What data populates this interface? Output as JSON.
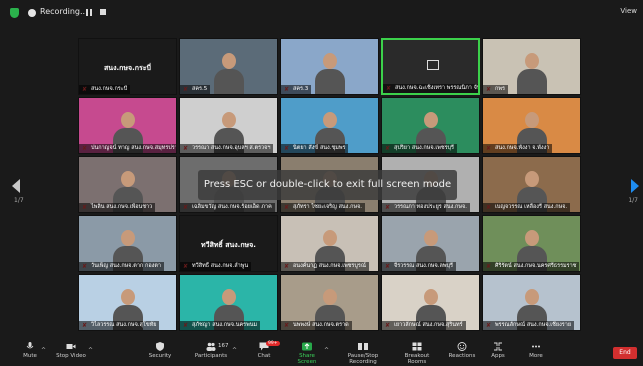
{
  "topbar": {
    "recording_label": "Recording...",
    "view_label": "View"
  },
  "esc_message": "Press ESC or double-click to exit full screen mode",
  "pagination": {
    "left": "1/7",
    "right": "1/7"
  },
  "participants": [
    {
      "name": "สนง.กษจ.กระบี่",
      "center_label": "สนง.กษจ.กระบี่",
      "bg": "#1a1a1a"
    },
    {
      "name": "สคร.5",
      "bg": "#5b6b78"
    },
    {
      "name": "สคร.3",
      "bg": "#8aa7c9"
    },
    {
      "name": "สนง.กษจ.ฉะเชิงเทรา พรรณนิภา จันทร์",
      "bg": "#2a2a2a",
      "video_off": true
    },
    {
      "name": "กพร",
      "bg": "#c9c2b4"
    },
    {
      "name": "ปนกาญจน์ ทาญ สนง.กษจ.สมุทรปราการ",
      "bg": "#c64a8f"
    },
    {
      "name": "วรรณา สนง.กษจ.อุบลฯ ส.ตรวจฯ",
      "bg": "#cfcfcf"
    },
    {
      "name": "นิตยา สังข์ สนง.ชุมพร",
      "bg": "#4f9dc9"
    },
    {
      "name": "สุปริยา สนง.กษจ.เพชรบุรี",
      "bg": "#2c8d5e"
    },
    {
      "name": "สนง.กษจ.พังงา จ.พังงา",
      "bg": "#d98a45"
    },
    {
      "name": "ไพลิน สนง.กษจ.เพื่อนชาว",
      "bg": "#7c7070"
    },
    {
      "name": "เฉลิมขวัญ สนง.กษจ.ร้อยเอ็ด ภาค",
      "bg": "#6d6d6d"
    },
    {
      "name": "สุภัทรา ไซยะเจริญ สนง.กษจ.",
      "bg": "#8a7e6e"
    },
    {
      "name": "วรรณภา ทองประยูร สนง.กษจ.",
      "bg": "#b0b0b0"
    },
    {
      "name": "เบญจวรรณ เหลืองรี สนง.กษจ.",
      "bg": "#8c6b4c"
    },
    {
      "name": "วันเพ็ญ สนง.กษจ.ตาก กองตา",
      "bg": "#8b9aa7"
    },
    {
      "name": "ทวีสิทธิ์ สนง.กษจ.ลำพูน",
      "center_label": "ทวีสิทธิ์ สนง.กษจ.",
      "bg": "#1a1a1a"
    },
    {
      "name": "อนงค์นาฏ สนง.กษจ.เพชรบูรณ์",
      "bg": "#c8c0b6"
    },
    {
      "name": "จีรวรรณ สนง.กษจ.ลพบุรี",
      "bg": "#9aa4ad"
    },
    {
      "name": "ศิริรัตน์ สนง.กษจ.นครศรีธรรมราช",
      "bg": "#6f8f5a"
    },
    {
      "name": "วิไลวรรณ สนง.กษจ.สุโขทัย",
      "bg": "#b9d0e4"
    },
    {
      "name": "สุภัชญา สนง.กษจ.นครพนม",
      "bg": "#2bb5a8"
    },
    {
      "name": "นพพงษ์ สนง.กษจ.ตราด",
      "bg": "#a89c8a"
    },
    {
      "name": "เยาวลักษณ์ สนง.กษจ.สุรินทร์",
      "bg": "#d9d2c7"
    },
    {
      "name": "พรรณลักษณ์ สนง.กษจ.เชียงราย",
      "bg": "#b6c2ce"
    }
  ],
  "toolbar": {
    "mute": "Mute",
    "stop_video": "Stop Video",
    "security": "Security",
    "participants": "Participants",
    "participants_count": "167",
    "chat": "Chat",
    "chat_badge": "99+",
    "share_screen": "Share Screen",
    "pause_recording": "Pause/Stop Recording",
    "breakout": "Breakout Rooms",
    "reactions": "Reactions",
    "apps": "Apps",
    "more": "More",
    "end": "End"
  }
}
